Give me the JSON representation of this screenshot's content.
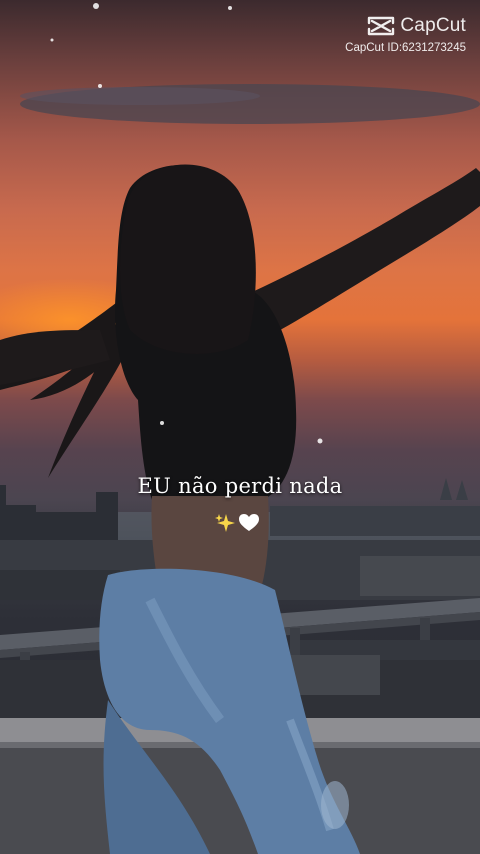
{
  "watermark": {
    "brand": "CapCut",
    "id_text": "CapCut ID:6231273245",
    "logo_icon": "capcut-logo-icon"
  },
  "caption": {
    "text": "EU não perdi nada",
    "emojis": [
      "sparkles-icon",
      "heart-icon"
    ]
  },
  "colors": {
    "sky_top": "#3c2a2e",
    "sunset": "#e4733a",
    "silhouette": "#141416",
    "jeans": "#5a7aa0",
    "caption_text": "#ffffff"
  }
}
